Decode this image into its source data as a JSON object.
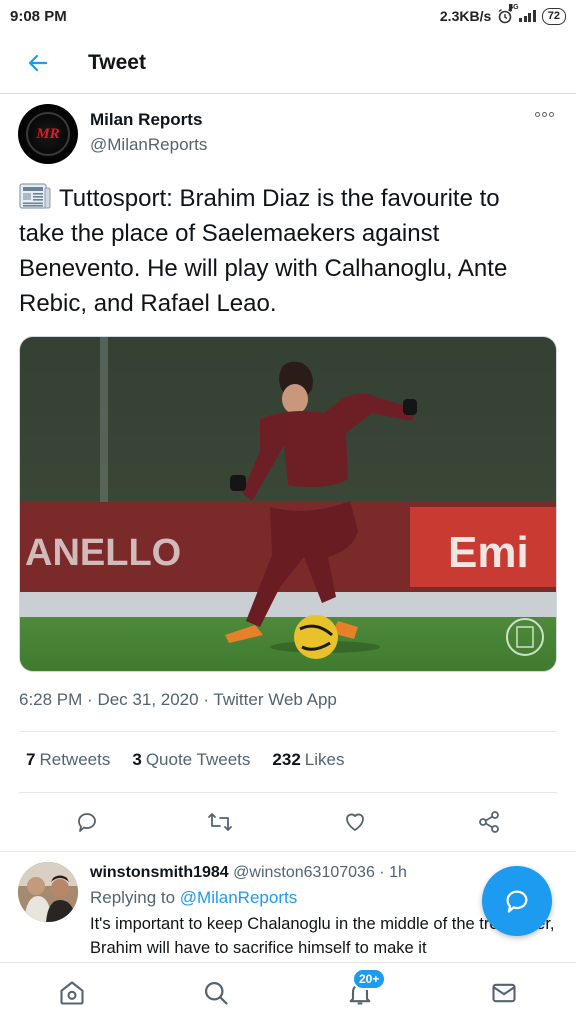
{
  "status_bar": {
    "time": "9:08 PM",
    "speed": "2.3KB/s",
    "network": "4G",
    "battery": "72"
  },
  "header": {
    "title": "Tweet"
  },
  "tweet": {
    "author_name": "Milan Reports",
    "author_handle": "@MilanReports",
    "avatar_text": "MR",
    "text": "Tuttosport: Brahim Diaz is the favourite to take the place of Saelemaekers against Benevento. He will play with Calhanoglu, Ante Rebic, and Rafael Leao.",
    "media": {
      "banner_left": "ANELLO",
      "banner_right": "Emi"
    },
    "meta": {
      "time": "6:28 PM",
      "date": "Dec 31, 2020",
      "source": "Twitter Web App",
      "sep": "·"
    },
    "stats": {
      "retweets_count": "7",
      "retweets_label": "Retweets",
      "quotes_count": "3",
      "quotes_label": "Quote Tweets",
      "likes_count": "232",
      "likes_label": "Likes"
    }
  },
  "reply": {
    "author_name": "winstonsmith1984",
    "author_handle": "@winston63107036",
    "sep": "·",
    "time": "1h",
    "replying_label": "Replying to",
    "replying_mention": "@MilanReports",
    "text": "It's important to keep Chalanoglu in the middle of the trequarter, Brahim will have to sacrifice himself to make it"
  },
  "bottom_nav": {
    "notifications_badge": "20+"
  },
  "colors": {
    "accent": "#1d9bf0",
    "text": "#0f1419",
    "muted": "#536471"
  }
}
